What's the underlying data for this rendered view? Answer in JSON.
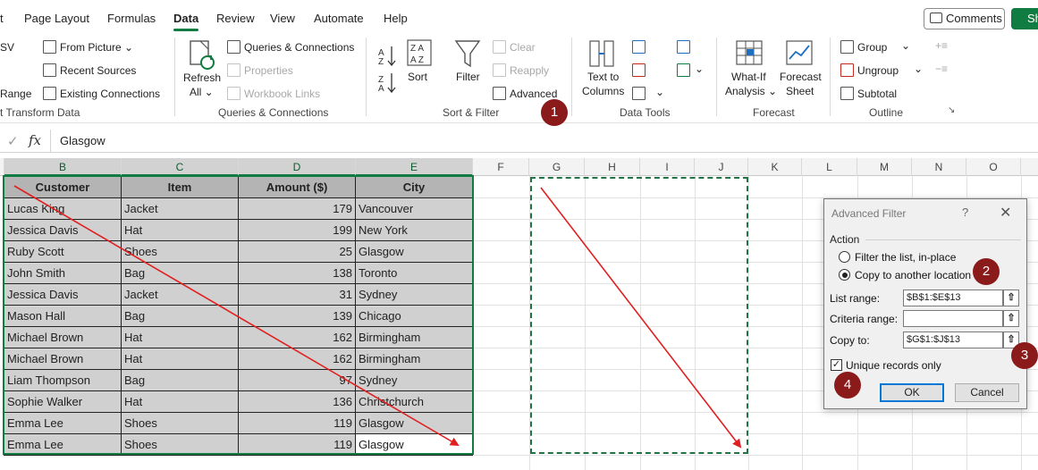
{
  "menu": {
    "tabs": [
      "t",
      "Page Layout",
      "Formulas",
      "Data",
      "Review",
      "View",
      "Automate",
      "Help"
    ],
    "comments": "Comments",
    "share": "Sh"
  },
  "ribbon": {
    "get_data": {
      "csv": "SV",
      "range": "Range",
      "label": "t Transform Data"
    },
    "queries_left": {
      "from_picture": "From Picture ⌄",
      "recent_sources": "Recent Sources",
      "existing_connections": "Existing Connections"
    },
    "refresh": {
      "label1": "Refresh",
      "label2": "All ⌄"
    },
    "queries_right": {
      "qc": "Queries & Connections",
      "properties": "Properties",
      "workbook_links": "Workbook Links"
    },
    "queries_group_label": "Queries & Connections",
    "sort_filter": {
      "sort": "Sort",
      "filter": "Filter",
      "clear": "Clear",
      "reapply": "Reapply",
      "advanced": "Advanced",
      "label": "Sort & Filter"
    },
    "data_tools": {
      "text_to_columns_1": "Text to",
      "text_to_columns_2": "Columns",
      "label": "Data Tools"
    },
    "forecast": {
      "whatif_1": "What-If",
      "whatif_2": "Analysis ⌄",
      "sheet_1": "Forecast",
      "sheet_2": "Sheet",
      "label": "Forecast"
    },
    "outline": {
      "group": "Group",
      "ungroup": "Ungroup",
      "subtotal": "Subtotal",
      "label": "Outline"
    }
  },
  "formula_bar": {
    "fx": "fx",
    "value": "Glasgow"
  },
  "columns": [
    "B",
    "C",
    "D",
    "E",
    "F",
    "G",
    "H",
    "I",
    "J",
    "K",
    "L",
    "M",
    "N",
    "O"
  ],
  "table": {
    "headers": [
      "Customer",
      "Item",
      "Amount ($)",
      "City"
    ],
    "rows": [
      [
        "Lucas King",
        "Jacket",
        "179",
        "Vancouver"
      ],
      [
        "Jessica Davis",
        "Hat",
        "199",
        "New York"
      ],
      [
        "Ruby Scott",
        "Shoes",
        "25",
        "Glasgow"
      ],
      [
        "John Smith",
        "Bag",
        "138",
        "Toronto"
      ],
      [
        "Jessica Davis",
        "Jacket",
        "31",
        "Sydney"
      ],
      [
        "Mason Hall",
        "Bag",
        "139",
        "Chicago"
      ],
      [
        "Michael Brown",
        "Hat",
        "162",
        "Birmingham"
      ],
      [
        "Michael Brown",
        "Hat",
        "162",
        "Birmingham"
      ],
      [
        "Liam Thompson",
        "Bag",
        "97",
        "Sydney"
      ],
      [
        "Sophie Walker",
        "Hat",
        "136",
        "Christchurch"
      ],
      [
        "Emma Lee",
        "Shoes",
        "119",
        "Glasgow"
      ],
      [
        "Emma Lee",
        "Shoes",
        "119",
        "Glasgow"
      ]
    ]
  },
  "dialog": {
    "title": "Advanced Filter",
    "help": "?",
    "close": "✕",
    "action": "Action",
    "opt_filter": "Filter the list, in-place",
    "opt_copy": "Copy to another location",
    "list_range_label": "List range:",
    "list_range_value": "$B$1:$E$13",
    "criteria_label": "Criteria range:",
    "criteria_value": "",
    "copy_to_label": "Copy to:",
    "copy_to_value": "$G$1:$J$13",
    "unique_label": "Unique records only",
    "ok": "OK",
    "cancel": "Cancel"
  },
  "callouts": [
    "1",
    "2",
    "3",
    "4"
  ],
  "colors": {
    "excel_green": "#107c41",
    "callout": "#8b1a1a",
    "arrow": "#e02020"
  }
}
